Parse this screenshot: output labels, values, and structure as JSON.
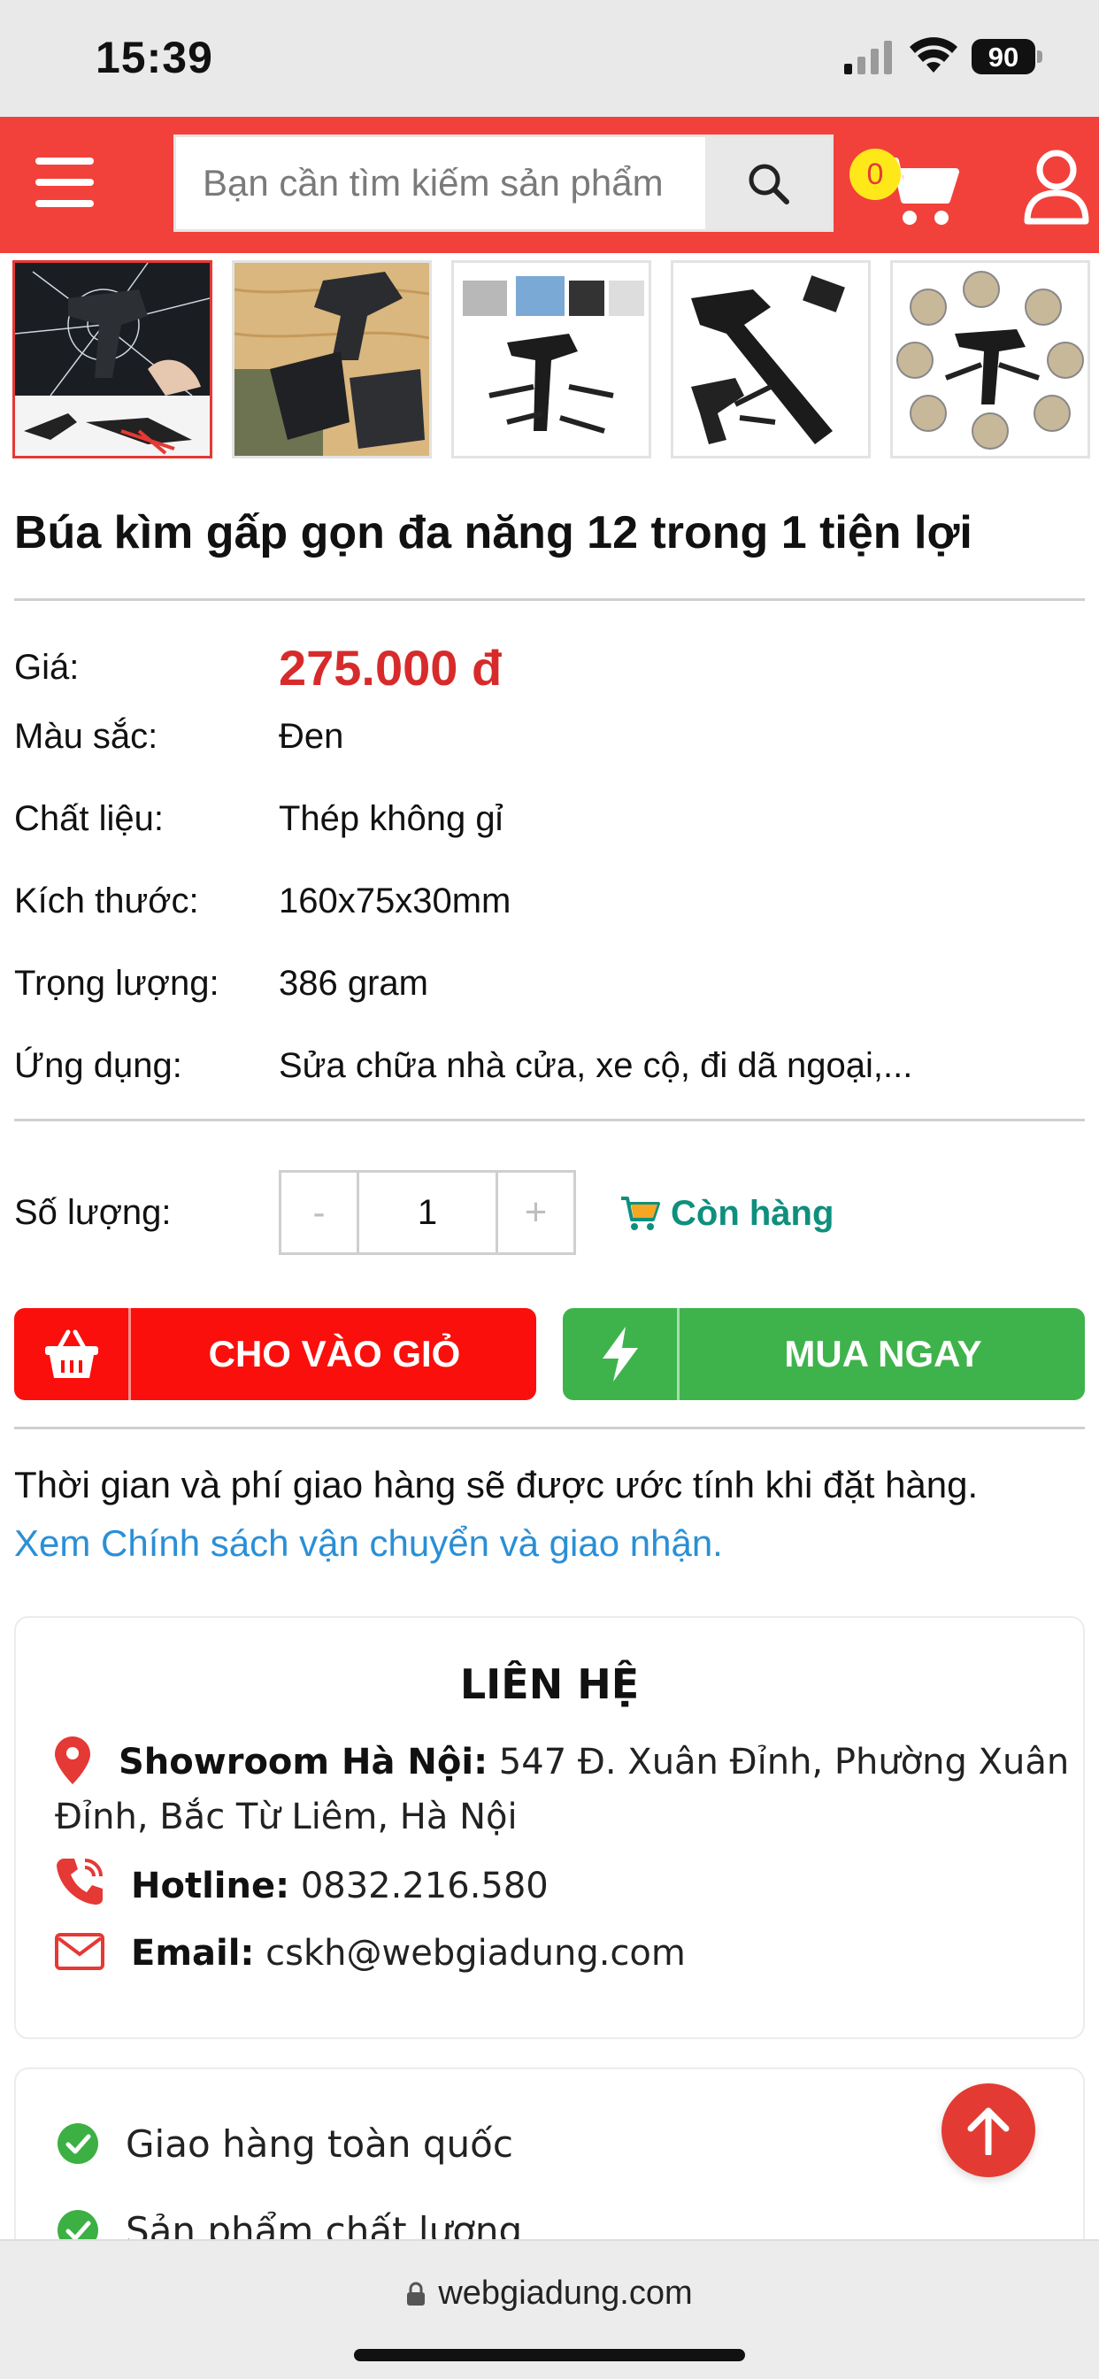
{
  "status_bar": {
    "time": "15:39",
    "battery": "90"
  },
  "header": {
    "search_placeholder": "Bạn cần tìm kiếm sản phẩm",
    "cart_count": "0",
    "brand_color": "#f2413b"
  },
  "thumbnails": [
    {
      "alt": "Búa kìm phá kính"
    },
    {
      "alt": "Búa kìm trên gỗ"
    },
    {
      "alt": "Bộ dụng cụ đa năng"
    },
    {
      "alt": "Búa kìm mở rộng"
    },
    {
      "alt": "Các chức năng dụng cụ"
    }
  ],
  "product": {
    "title": "Búa kìm gấp gọn đa năng 12 trong 1 tiện lợi",
    "price_label": "Giá:",
    "price": "275.000 đ",
    "specs": [
      {
        "label": "Màu sắc:",
        "value": "Đen"
      },
      {
        "label": "Chất liệu:",
        "value": "Thép không gỉ"
      },
      {
        "label": "Kích thước:",
        "value": "160x75x30mm"
      },
      {
        "label": "Trọng lượng:",
        "value": "386 gram"
      },
      {
        "label": "Ứng dụng:",
        "value": "Sửa chữa nhà cửa, xe cộ, đi dã ngoại,..."
      }
    ]
  },
  "quantity": {
    "label": "Số lượng:",
    "minus": "-",
    "value": "1",
    "plus": "+",
    "stock_status": "Còn hàng"
  },
  "actions": {
    "add_to_cart": "CHO VÀO GIỎ",
    "buy_now": "MUA NGAY",
    "cart_color": "#fa0f0c",
    "buy_color": "#3fb34b"
  },
  "shipping": {
    "note": "Thời gian và phí giao hàng sẽ được ước tính khi đặt hàng.",
    "policy_link": "Xem Chính sách vận chuyển và giao nhận."
  },
  "contact": {
    "title": "LIÊN HỆ",
    "showroom_label": "Showroom Hà Nội:",
    "showroom_address_1": "547 Đ. Xuân Đỉnh, Phường Xuân",
    "showroom_address_2": "Đỉnh, Bắc Từ Liêm, Hà Nội",
    "hotline_label": "Hotline:",
    "hotline": "0832.216.580",
    "email_label": "Email:",
    "email": "cskh@webgiadung.com"
  },
  "features": [
    {
      "label": "Giao hàng toàn quốc"
    },
    {
      "label": "Sản phẩm chất lượng"
    }
  ],
  "browser": {
    "url": "webgiadung.com"
  }
}
